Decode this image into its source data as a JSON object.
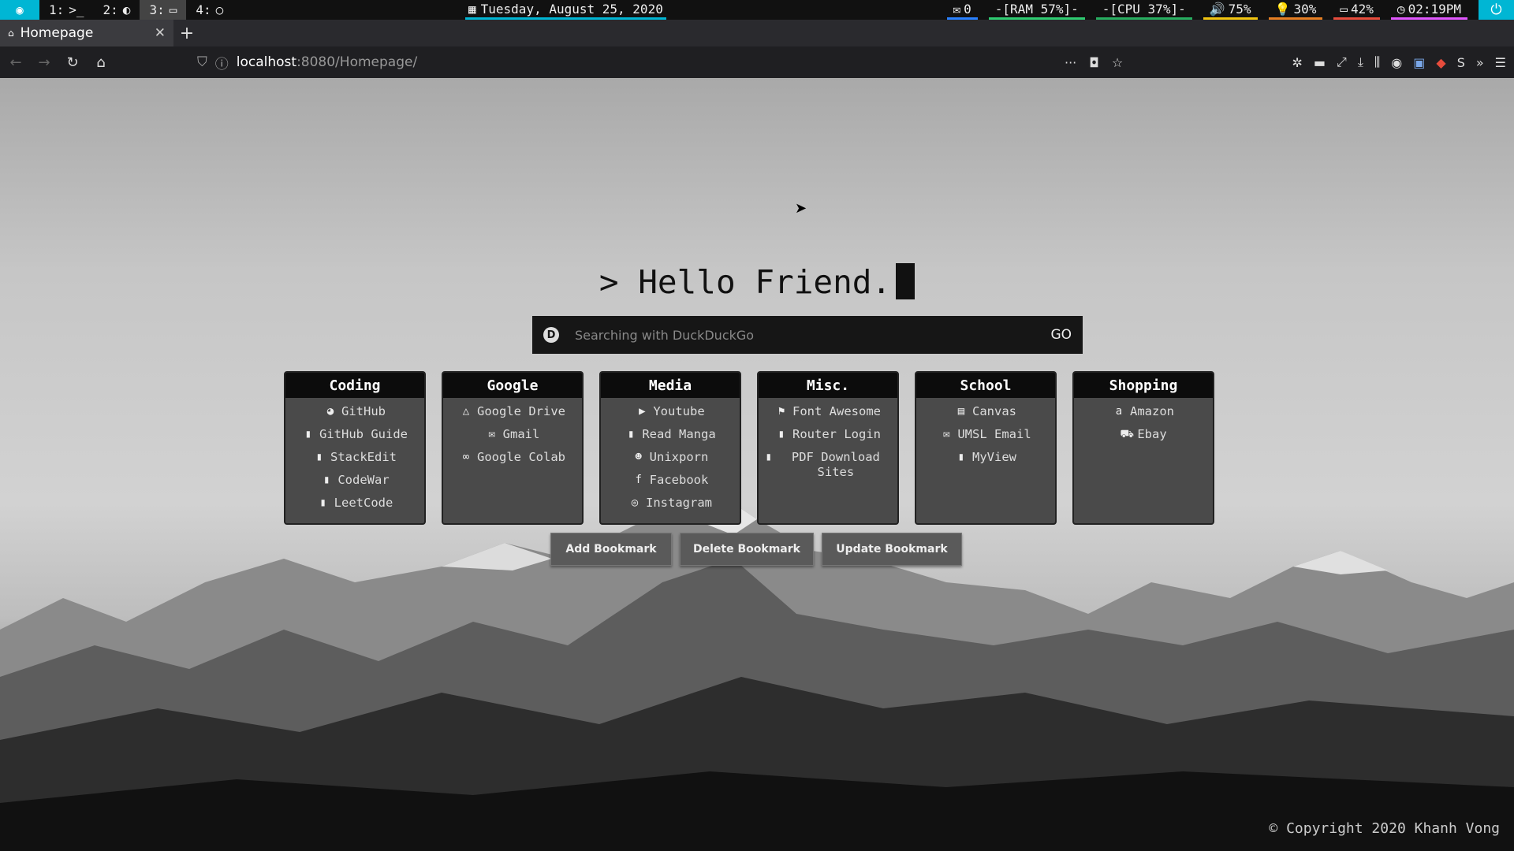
{
  "system_bar": {
    "workspaces": [
      {
        "label": "1:",
        "icon": ">_"
      },
      {
        "label": "2:",
        "icon": "◐"
      },
      {
        "label": "3:",
        "icon": "▭"
      },
      {
        "label": "4:",
        "icon": "○"
      }
    ],
    "date": "Tuesday,  August 25, 2020",
    "mail_count": "0",
    "ram": "-[RAM 57%]-",
    "cpu": "-[CPU 37%]-",
    "volume": "75%",
    "brightness": "30%",
    "battery": "42%",
    "clock": "02:19PM",
    "colors": {
      "accent": "#00b6d4",
      "ram": "#2ecc71",
      "cpu": "#27ae60",
      "volume": "#f1c40f",
      "brightness": "#e67e22",
      "battery": "#e74c3c",
      "clock": "#e056fd"
    }
  },
  "browser": {
    "tab_title": "Homepage",
    "url_host": "localhost",
    "url_path": ":8080/Homepage/"
  },
  "page": {
    "greeting": "> Hello Friend.",
    "search": {
      "placeholder": "Searching with DuckDuckGo",
      "go_label": "GO"
    },
    "categories": [
      {
        "title": "Coding",
        "items": [
          {
            "icon": "github-icon",
            "label": "GitHub"
          },
          {
            "icon": "bookmark-icon",
            "label": "GitHub Guide"
          },
          {
            "icon": "bookmark-icon",
            "label": "StackEdit"
          },
          {
            "icon": "bookmark-icon",
            "label": "CodeWar"
          },
          {
            "icon": "bookmark-icon",
            "label": "LeetCode"
          }
        ]
      },
      {
        "title": "Google",
        "items": [
          {
            "icon": "google-drive-icon",
            "label": "Google Drive"
          },
          {
            "icon": "envelope-icon",
            "label": "Gmail"
          },
          {
            "icon": "infinity-icon",
            "label": "Google Colab"
          }
        ]
      },
      {
        "title": "Media",
        "items": [
          {
            "icon": "youtube-icon",
            "label": "Youtube"
          },
          {
            "icon": "bookmark-icon",
            "label": "Read Manga"
          },
          {
            "icon": "reddit-icon",
            "label": "Unixporn"
          },
          {
            "icon": "facebook-icon",
            "label": "Facebook"
          },
          {
            "icon": "instagram-icon",
            "label": "Instagram"
          }
        ]
      },
      {
        "title": "Misc.",
        "items": [
          {
            "icon": "font-awesome-icon",
            "label": "Font Awesome"
          },
          {
            "icon": "bookmark-icon",
            "label": "Router Login"
          },
          {
            "icon": "bookmark-icon",
            "label": "PDF Download Sites"
          }
        ]
      },
      {
        "title": "School",
        "items": [
          {
            "icon": "chalkboard-icon",
            "label": "Canvas"
          },
          {
            "icon": "mail-bulk-icon",
            "label": "UMSL Email"
          },
          {
            "icon": "bookmark-icon",
            "label": "MyView"
          }
        ]
      },
      {
        "title": "Shopping",
        "items": [
          {
            "icon": "amazon-icon",
            "label": "Amazon"
          },
          {
            "icon": "cart-icon",
            "label": "Ebay"
          }
        ]
      }
    ],
    "buttons": {
      "add": "Add Bookmark",
      "delete": "Delete Bookmark",
      "update": "Update Bookmark"
    },
    "copyright": "© Copyright 2020 Khanh Vong"
  }
}
